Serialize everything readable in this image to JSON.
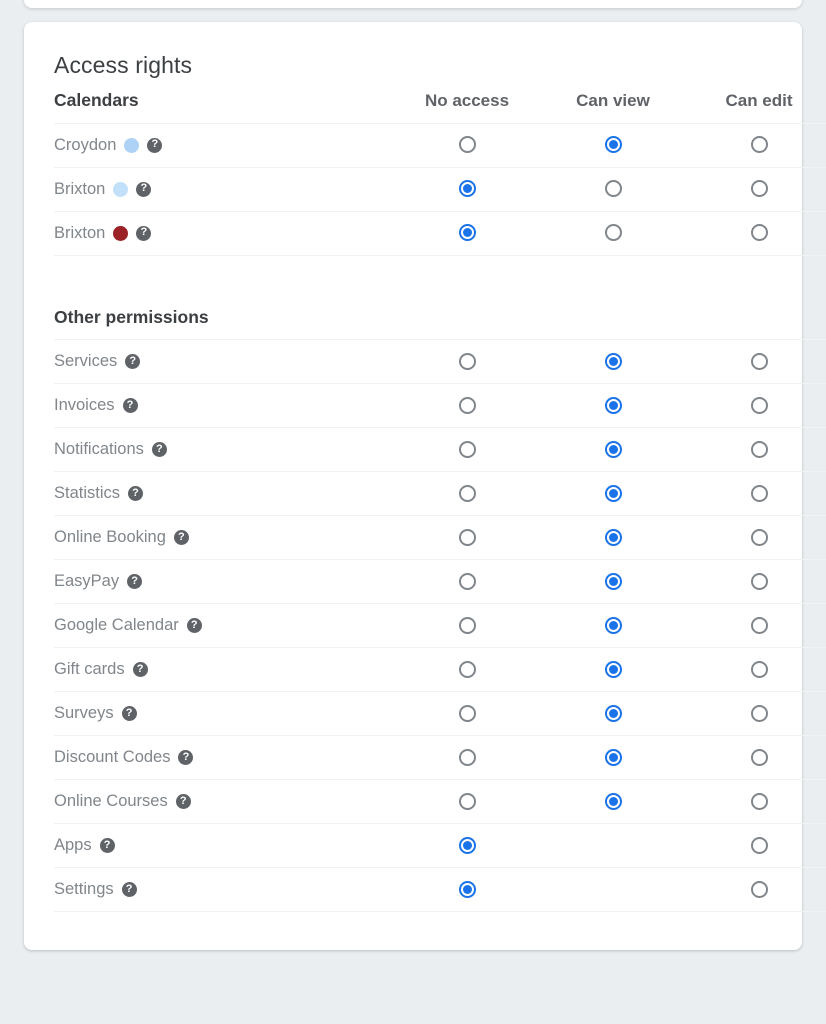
{
  "card": {
    "title": "Access rights"
  },
  "columns": {
    "label_header": "Calendars",
    "options": [
      "No access",
      "Can view",
      "Can edit"
    ]
  },
  "sections": [
    {
      "heading": "Calendars",
      "rows": [
        {
          "label": "Croydon",
          "dot_color": "#aed2f6",
          "help_icon": "help-icon",
          "selected": 1
        },
        {
          "label": "Brixton",
          "dot_color": "#c3e0fb",
          "help_icon": "help-icon",
          "selected": 0
        },
        {
          "label": "Brixton",
          "dot_color": "#9b2226",
          "help_icon": "help-icon",
          "selected": 0
        }
      ]
    },
    {
      "heading": "Other permissions",
      "rows": [
        {
          "label": "Services",
          "help_icon": "help-icon",
          "selected": 1,
          "options": [
            true,
            true,
            true
          ]
        },
        {
          "label": "Invoices",
          "help_icon": "help-icon",
          "selected": 1,
          "options": [
            true,
            true,
            true
          ]
        },
        {
          "label": "Notifications",
          "help_icon": "help-icon",
          "selected": 1,
          "options": [
            true,
            true,
            true
          ]
        },
        {
          "label": "Statistics",
          "help_icon": "help-icon",
          "selected": 1,
          "options": [
            true,
            true,
            true
          ]
        },
        {
          "label": "Online Booking",
          "help_icon": "help-icon",
          "selected": 1,
          "options": [
            true,
            true,
            true
          ]
        },
        {
          "label": "EasyPay",
          "help_icon": "help-icon",
          "selected": 1,
          "options": [
            true,
            true,
            true
          ]
        },
        {
          "label": "Google Calendar",
          "help_icon": "help-icon",
          "selected": 1,
          "options": [
            true,
            true,
            true
          ]
        },
        {
          "label": "Gift cards",
          "help_icon": "help-icon",
          "selected": 1,
          "options": [
            true,
            true,
            true
          ]
        },
        {
          "label": "Surveys",
          "help_icon": "help-icon",
          "selected": 1,
          "options": [
            true,
            true,
            true
          ]
        },
        {
          "label": "Discount Codes",
          "help_icon": "help-icon",
          "selected": 1,
          "options": [
            true,
            true,
            true
          ]
        },
        {
          "label": "Online Courses",
          "help_icon": "help-icon",
          "selected": 1,
          "options": [
            true,
            true,
            true
          ]
        },
        {
          "label": "Apps",
          "help_icon": "help-icon",
          "selected": 0,
          "options": [
            true,
            false,
            true
          ]
        },
        {
          "label": "Settings",
          "help_icon": "help-icon",
          "selected": 0,
          "options": [
            true,
            false,
            true
          ]
        }
      ]
    }
  ],
  "colors": {
    "accent": "#1a73e8",
    "radio_border": "#80868b",
    "page_background": "#eaeef1",
    "card_background": "#ffffff",
    "divider": "#f1f3f4",
    "label_text": "#80868b",
    "heading_text": "#3c4043",
    "column_header_text": "#5f6368"
  },
  "help_glyph": "?"
}
